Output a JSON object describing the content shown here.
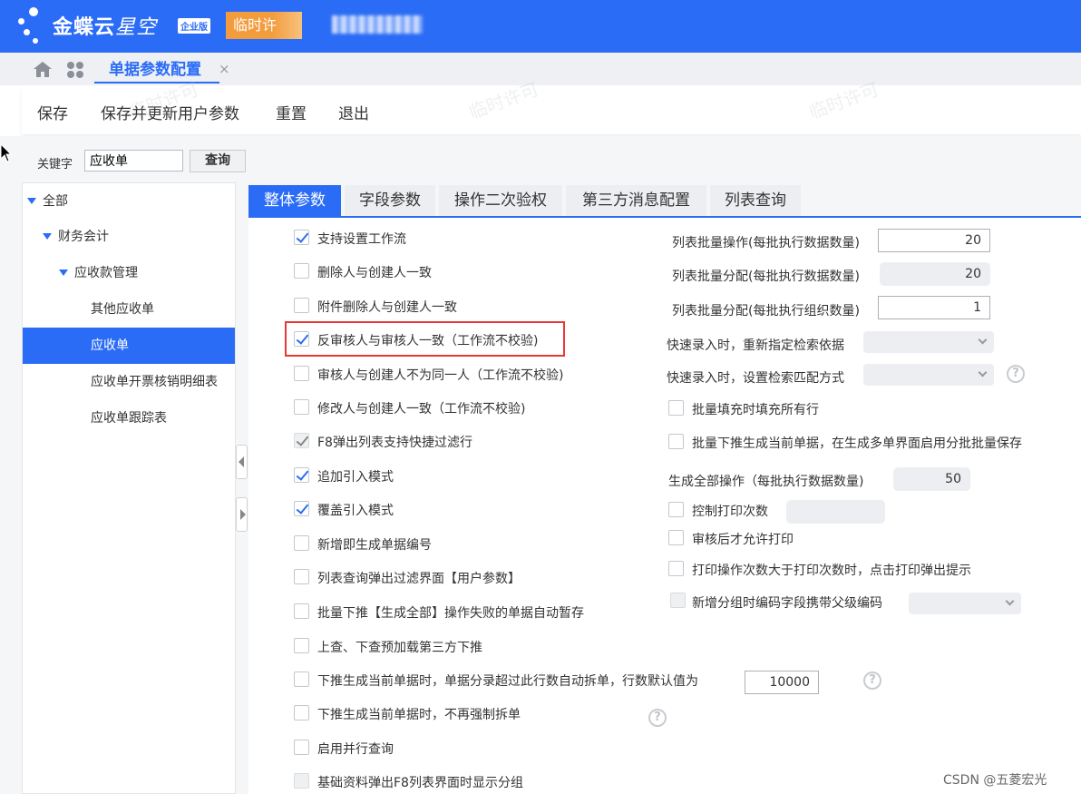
{
  "header": {
    "brand_main": "金蝶云",
    "brand_sub": "星空",
    "edition": "企业版",
    "license": "临时许",
    "colors": {
      "bar": "#2b6cf6",
      "license": "#f39c3d"
    }
  },
  "tabs": {
    "home_icon": "home-icon",
    "apps_icon": "apps-grid-icon",
    "active_label": "单据参数配置",
    "close_label": "×"
  },
  "toolbar": {
    "save": "保存",
    "save_update": "保存并更新用户参数",
    "reset": "重置",
    "exit": "退出"
  },
  "search": {
    "label": "关键字",
    "value": "应收单",
    "button": "查询"
  },
  "tree": {
    "items": [
      {
        "label": "全部"
      },
      {
        "label": "财务会计"
      },
      {
        "label": "应收款管理"
      },
      {
        "label": "其他应收单"
      },
      {
        "label": "应收单",
        "selected": true
      },
      {
        "label": "应收单开票核销明细表"
      },
      {
        "label": "应收单跟踪表"
      }
    ]
  },
  "param_tabs": [
    {
      "label": "整体参数",
      "active": true
    },
    {
      "label": "字段参数"
    },
    {
      "label": "操作二次验权"
    },
    {
      "label": "第三方消息配置"
    },
    {
      "label": "列表查询"
    }
  ],
  "left_options": [
    {
      "label": "支持设置工作流",
      "checked": true
    },
    {
      "label": "删除人与创建人一致",
      "checked": false
    },
    {
      "label": "附件删除人与创建人一致",
      "checked": false
    },
    {
      "label": "反审核人与审核人一致（工作流不校验)",
      "checked": true,
      "highlighted": true
    },
    {
      "label": "审核人与创建人不为同一人（工作流不校验)",
      "checked": false
    },
    {
      "label": "修改人与创建人一致（工作流不校验)",
      "checked": false
    },
    {
      "label": "F8弹出列表支持快捷过滤行",
      "checked": true,
      "disabled": true
    },
    {
      "label": "追加引入模式",
      "checked": true
    },
    {
      "label": "覆盖引入模式",
      "checked": true
    },
    {
      "label": "新增即生成单据编号",
      "checked": false
    },
    {
      "label": "列表查询弹出过滤界面【用户参数】",
      "checked": false
    },
    {
      "label": "批量下推【生成全部】操作失败的单据自动暂存",
      "checked": false
    },
    {
      "label": "上查、下查预加载第三方下推",
      "checked": false
    },
    {
      "label": "下推生成当前单据时，单据分录超过此行数自动拆单，行数默认值为",
      "checked": false,
      "value": "10000"
    },
    {
      "label": "下推生成当前单据时，不再强制拆单",
      "checked": false
    },
    {
      "label": "启用并行查询",
      "checked": false
    },
    {
      "label": "基础资料弹出F8列表界面时显示分组",
      "checked": false,
      "disabled": true
    }
  ],
  "right_fields": {
    "batch_op_label": "列表批量操作(每批执行数据数量)",
    "batch_op_value": "20",
    "batch_assign_label": "列表批量分配(每批执行数据数量)",
    "batch_assign_value": "20",
    "batch_assign_org_label": "列表批量分配(每批执行组织数量)",
    "batch_assign_org_value": "1",
    "quick_entry_reassign_label": "快速录入时，重新指定检索依据",
    "quick_entry_match_label": "快速录入时，设置检索匹配方式",
    "batch_fill_label": "批量填充时填充所有行",
    "batch_push_label": "批量下推生成当前单据，在生成多单界面启用分批批量保存",
    "generate_all_label": "生成全部操作（每批执行数据数量)",
    "generate_all_value": "50",
    "print_count_label": "控制打印次数",
    "print_after_audit_label": "审核后才允许打印",
    "print_prompt_label": "打印操作次数大于打印次数时，点击打印弹出提示",
    "group_code_label": "新增分组时编码字段携带父级编码",
    "help_glyph": "?"
  },
  "watermark": {
    "text": "临时许可",
    "credit": "CSDN @五菱宏光"
  }
}
